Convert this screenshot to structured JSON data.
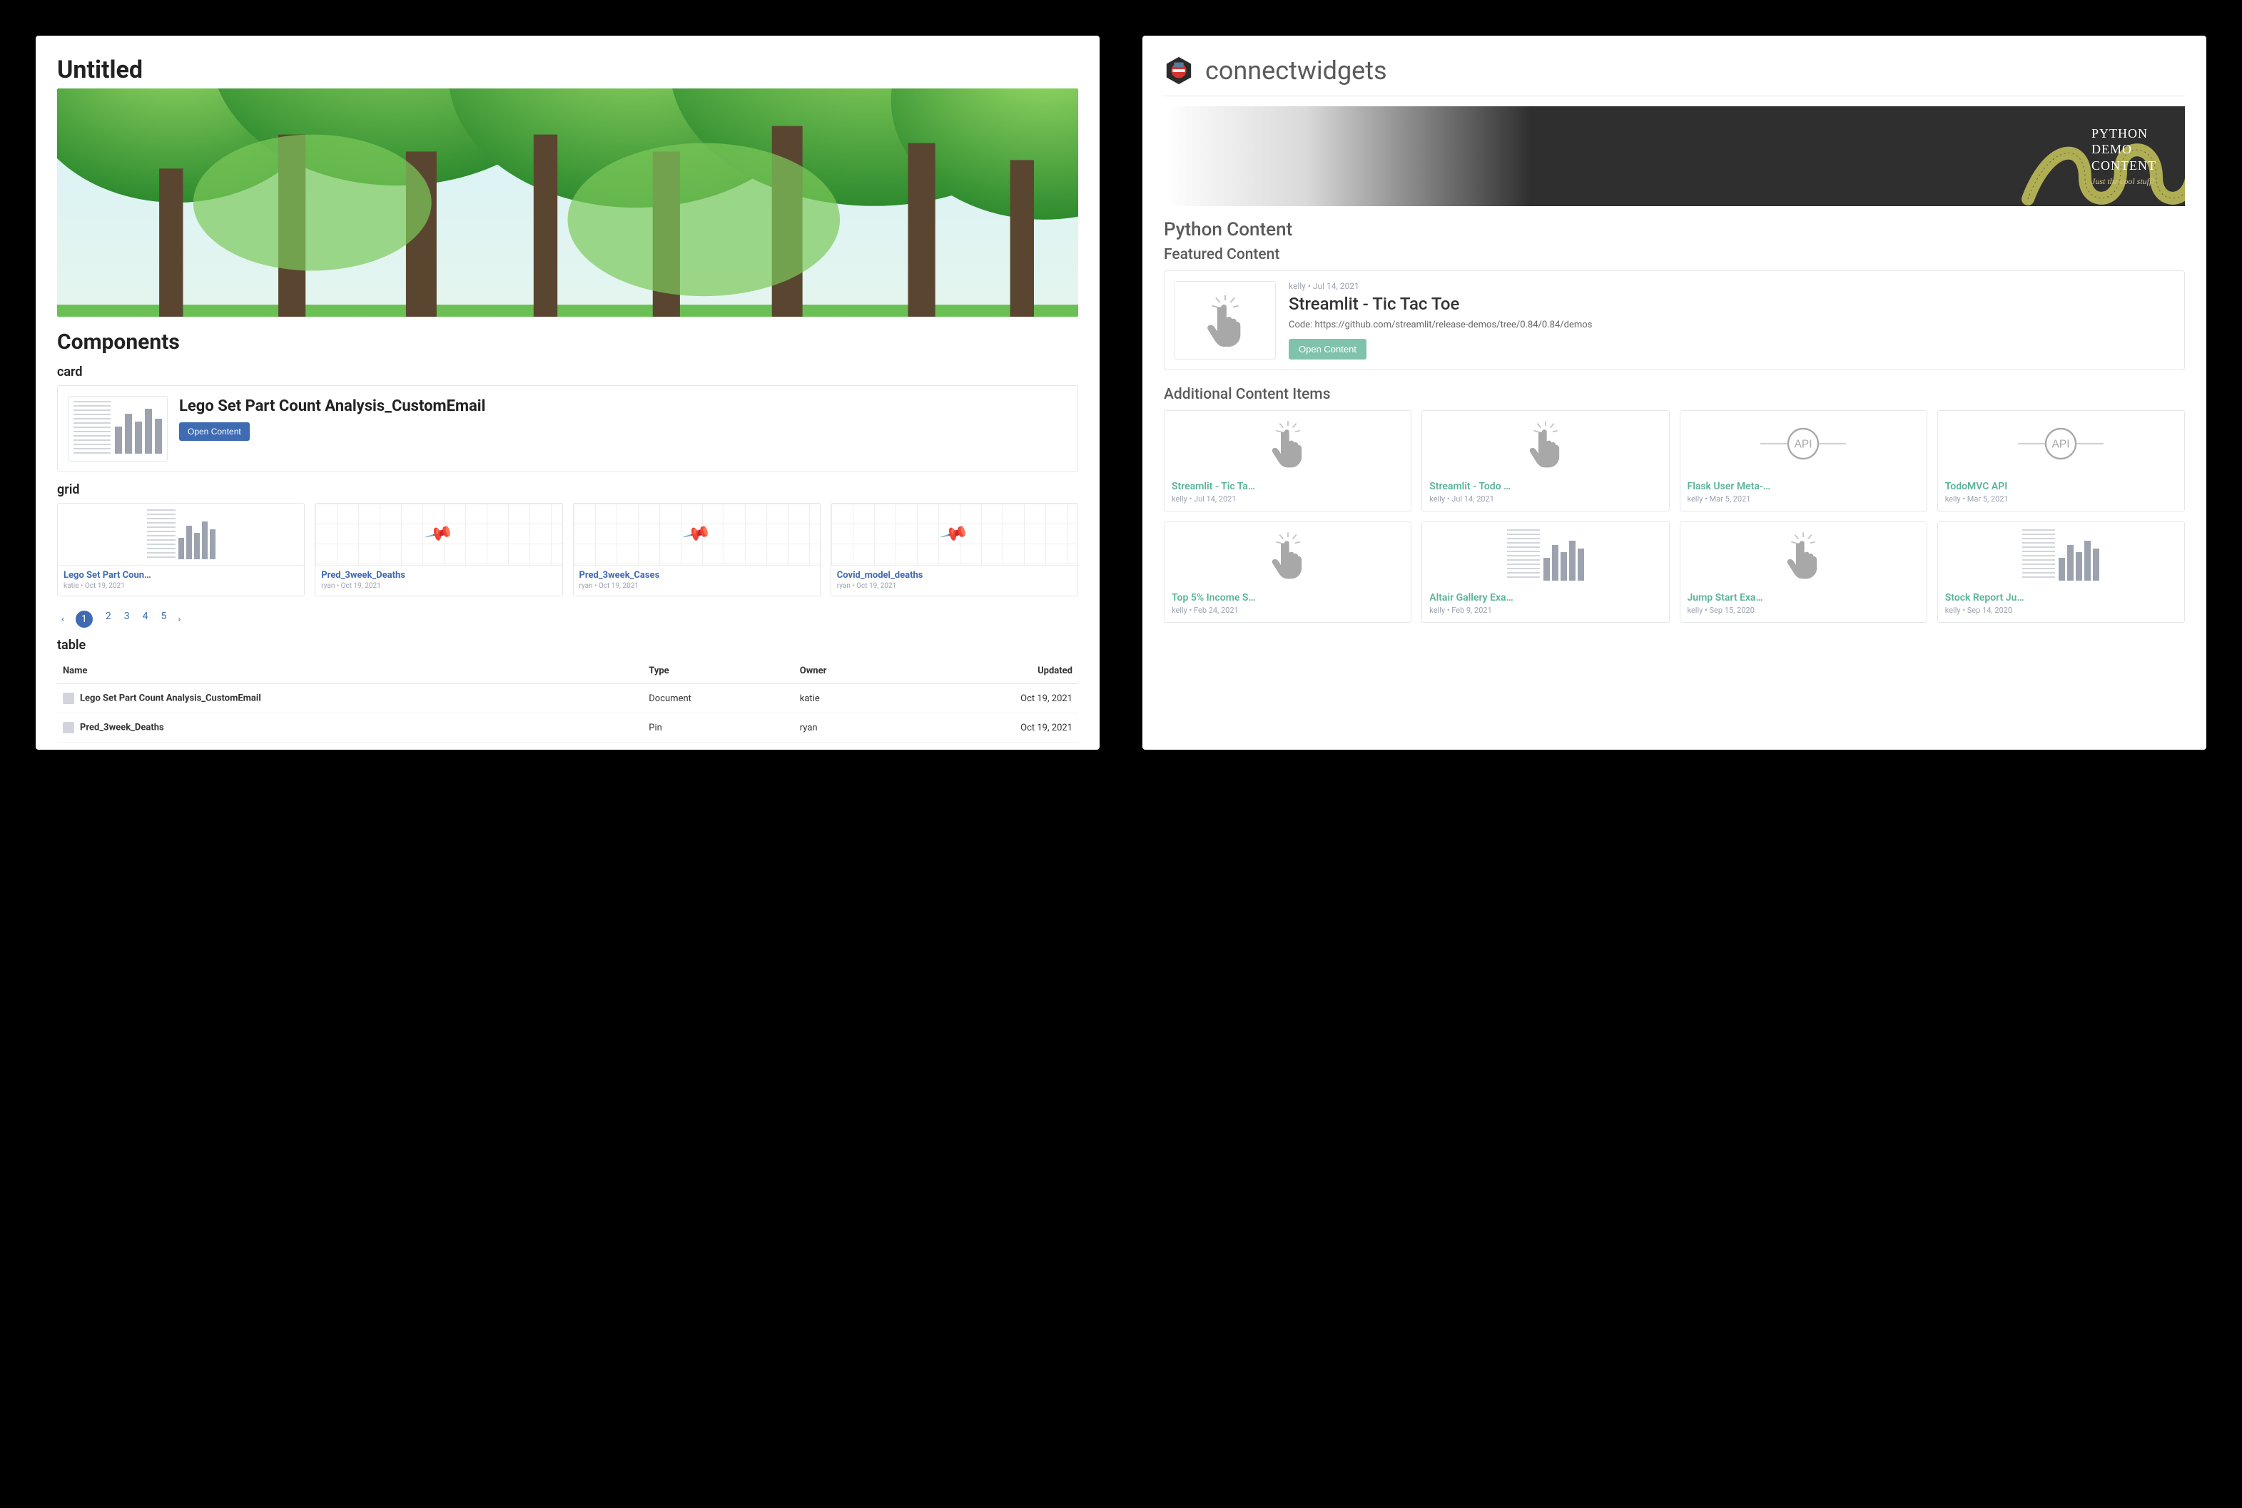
{
  "left": {
    "title": "Untitled",
    "section_components": "Components",
    "subsection_card": "card",
    "card": {
      "title": "Lego Set Part Count Analysis_CustomEmail",
      "open": "Open Content"
    },
    "subsection_grid": "grid",
    "grid_items": [
      {
        "title": "Lego Set Part Coun…",
        "meta": "katie • Oct 19, 2021",
        "kind": "bars"
      },
      {
        "title": "Pred_3week_Deaths",
        "meta": "ryan • Oct 19, 2021",
        "kind": "pin"
      },
      {
        "title": "Pred_3week_Cases",
        "meta": "ryan • Oct 19, 2021",
        "kind": "pin"
      },
      {
        "title": "Covid_model_deaths",
        "meta": "ryan • Oct 19, 2021",
        "kind": "pin"
      }
    ],
    "pager": {
      "pages": [
        "1",
        "2",
        "3",
        "4",
        "5"
      ],
      "active_index": 0
    },
    "subsection_table": "table",
    "table": {
      "headers": [
        "Name",
        "Type",
        "Owner",
        "Updated"
      ],
      "rows": [
        {
          "name": "Lego Set Part Count Analysis_CustomEmail",
          "type": "Document",
          "owner": "katie",
          "updated": "Oct 19, 2021"
        },
        {
          "name": "Pred_3week_Deaths",
          "type": "Pin",
          "owner": "ryan",
          "updated": "Oct 19, 2021"
        }
      ]
    }
  },
  "right": {
    "brand": "connectwidgets",
    "banner": {
      "line1": "PYTHON",
      "line2": "DEMO",
      "line3": "CONTENT",
      "sub": "Just the cool stuff!"
    },
    "h_section": "Python Content",
    "h_featured": "Featured Content",
    "featured": {
      "meta": "kelly • Jul 14, 2021",
      "title": "Streamlit - Tic Tac Toe",
      "desc": "Code: https://github.com/streamlit/release-demos/tree/0.84/0.84/demos",
      "open": "Open Content"
    },
    "h_additional": "Additional Content Items",
    "items": [
      {
        "title": "Streamlit - Tic Ta…",
        "meta": "kelly • Jul 14, 2021",
        "kind": "pointer"
      },
      {
        "title": "Streamlit - Todo …",
        "meta": "kelly • Jul 14, 2021",
        "kind": "pointer"
      },
      {
        "title": "Flask User Meta-…",
        "meta": "kelly • Mar 5, 2021",
        "kind": "api"
      },
      {
        "title": "TodoMVC API",
        "meta": "kelly • Mar 5, 2021",
        "kind": "api"
      },
      {
        "title": "Top 5% Income S…",
        "meta": "kelly • Feb 24, 2021",
        "kind": "pointer"
      },
      {
        "title": "Altair Gallery Exa…",
        "meta": "kelly • Feb 9, 2021",
        "kind": "bars"
      },
      {
        "title": "Jump Start Exa…",
        "meta": "kelly • Sep 15, 2020",
        "kind": "pointer"
      },
      {
        "title": "Stock Report Ju…",
        "meta": "kelly • Sep 14, 2020",
        "kind": "bars"
      }
    ]
  }
}
